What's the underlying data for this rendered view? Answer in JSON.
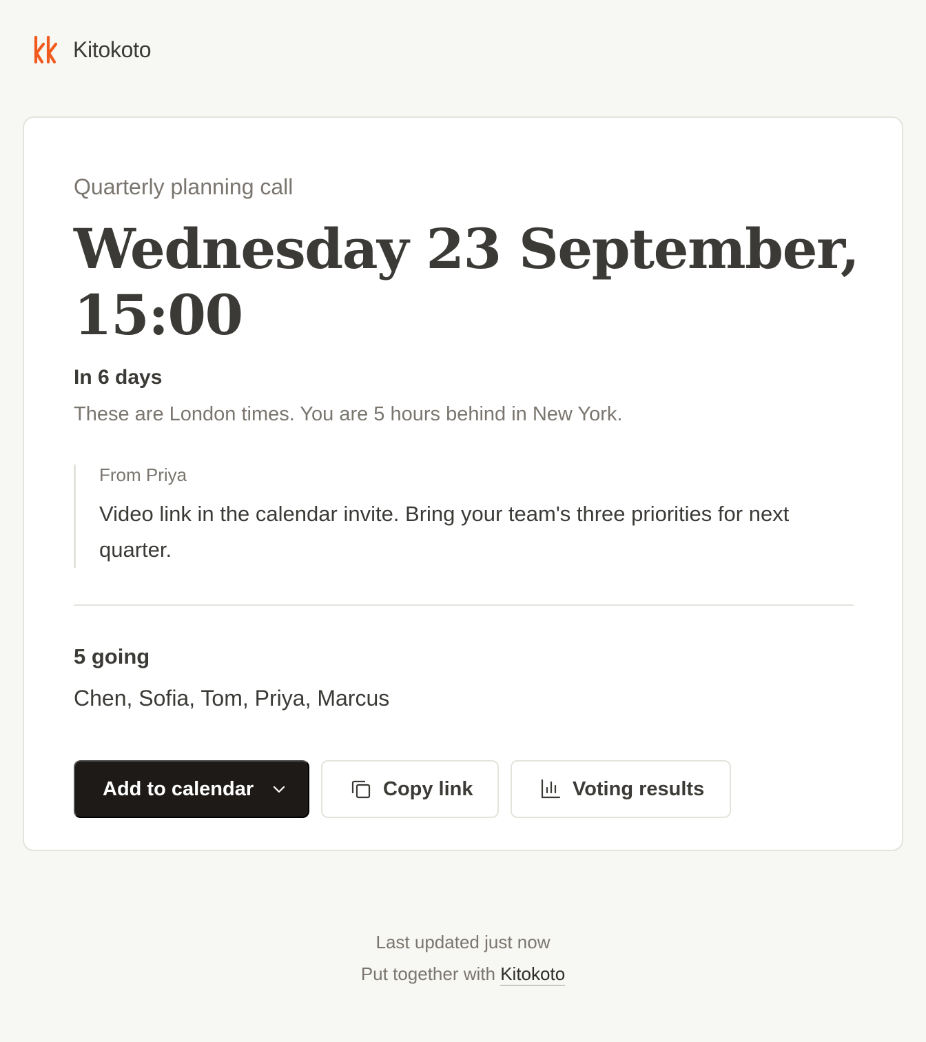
{
  "header": {
    "logo_icon": "kk-logo-icon",
    "brand_name": "Kitokoto",
    "brand_color": "#f05a1e"
  },
  "event": {
    "name": "Quarterly planning call",
    "datetime_line1": "Wednesday 23 September,",
    "datetime_line2": "15:00",
    "relative_time": "In 6 days",
    "timezone_note": "These are London times. You are 5 hours behind in New York."
  },
  "message": {
    "from": "From Priya",
    "body": "Video link in the calendar invite. Bring your team's three priorities for next quarter."
  },
  "attendance": {
    "going_label": "5 going",
    "attendees": "Chen, Sofia, Tom, Priya, Marcus"
  },
  "actions": {
    "add_to_calendar": {
      "label": "Add to calendar",
      "icon": "chevron-down-icon"
    },
    "copy_link": {
      "label": "Copy link",
      "icon": "copy-icon"
    },
    "voting_results": {
      "label": "Voting results",
      "icon": "bar-chart-icon"
    }
  },
  "footer": {
    "updated": "Last updated just now",
    "credit_prefix": "Put together with",
    "credit_link": "Kitokoto"
  },
  "colors": {
    "background": "#f7f7f3",
    "card": "#ffffff",
    "primary_button": "#1e1a17",
    "text": "#3b3a36",
    "muted_text": "#7a766f",
    "border": "#e4e3dd"
  }
}
